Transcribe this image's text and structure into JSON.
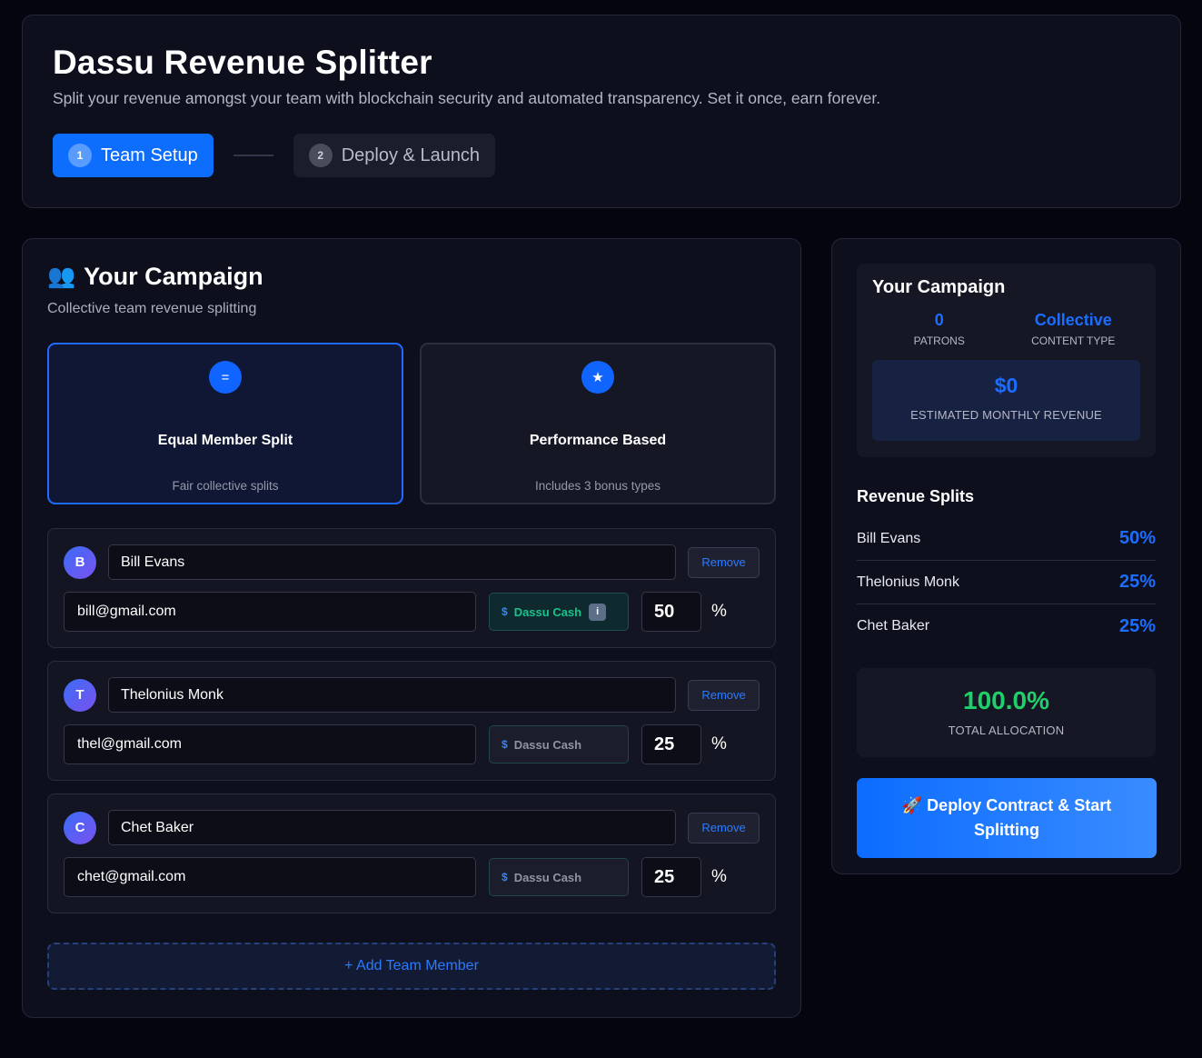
{
  "header": {
    "title": "Dassu Revenue Splitter",
    "subtitle": "Split your revenue amongst your team with blockchain security and automated transparency. Set it once, earn forever.",
    "steps": [
      {
        "num": "1",
        "label": "Team Setup"
      },
      {
        "num": "2",
        "label": "Deploy & Launch"
      }
    ]
  },
  "campaign": {
    "emoji": "👥",
    "title": "Your Campaign",
    "subtitle": "Collective team revenue splitting",
    "options": [
      {
        "icon": "=",
        "title": "Equal Member Split",
        "desc": "Fair collective splits"
      },
      {
        "icon": "★",
        "title": "Performance Based",
        "desc": "Includes 3 bonus types"
      }
    ],
    "remove_label": "Remove",
    "cash_dollar": "$",
    "cash_label": "Dassu Cash",
    "pct_sign": "%",
    "members": [
      {
        "initial": "B",
        "name": "Bill Evans",
        "email": "bill@gmail.com",
        "pct": "50"
      },
      {
        "initial": "T",
        "name": "Thelonius Monk",
        "email": "thel@gmail.com",
        "pct": "25"
      },
      {
        "initial": "C",
        "name": "Chet Baker",
        "email": "chet@gmail.com",
        "pct": "25"
      }
    ],
    "add_member_label": "+ Add Team Member"
  },
  "summary": {
    "title": "Your Campaign",
    "patrons_value": "0",
    "patrons_label": "PATRONS",
    "content_type_value": "Collective",
    "content_type_label": "CONTENT TYPE",
    "revenue_value": "$0",
    "revenue_label": "ESTIMATED MONTHLY REVENUE",
    "splits_title": "Revenue Splits",
    "splits": [
      {
        "name": "Bill Evans",
        "pct": "50%"
      },
      {
        "name": "Thelonius Monk",
        "pct": "25%"
      },
      {
        "name": "Chet Baker",
        "pct": "25%"
      }
    ],
    "total_value": "100.0%",
    "total_label": "TOTAL ALLOCATION",
    "deploy_label": "🚀 Deploy Contract & Start Splitting"
  },
  "colors": {
    "accent": "#0d6efd",
    "success": "#1fd06a",
    "background": "#050510",
    "card": "#0e0f1c"
  }
}
